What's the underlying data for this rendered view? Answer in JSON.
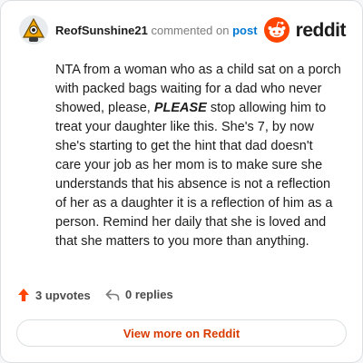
{
  "comment": {
    "author": "ReofSunshine21",
    "action_text": "commented on",
    "post_link_text": "post",
    "body": {
      "part1": "NTA from a woman who as a child sat on a porch with packed bags waiting for a dad who never showed, please, ",
      "emphasis": "PLEASE",
      "part2": " stop allowing him to treat your daughter like this. She's 7, by now she's starting to get the hint that dad doesn't care your job as her mom is to make sure she understands that his absence is not a reflection of her as a daughter it is a reflection of him as a person. Remind her daily that she is loved and that she matters to you more than anything."
    },
    "upvotes": "3 upvotes",
    "replies": "0 replies"
  },
  "brand": {
    "wordmark": "reddit",
    "icon": "reddit-logo-icon",
    "color": "#ff4500"
  },
  "footer": {
    "view_more_label": "View more on Reddit"
  },
  "colors": {
    "accent": "#ff4500",
    "link": "#0079d3",
    "button_text": "#d93a00",
    "upvote": "#ff4500"
  },
  "icons": {
    "avatar": "snoo-avatar-icon",
    "upvote": "upvote-arrow-icon",
    "reply": "reply-arrow-icon"
  }
}
